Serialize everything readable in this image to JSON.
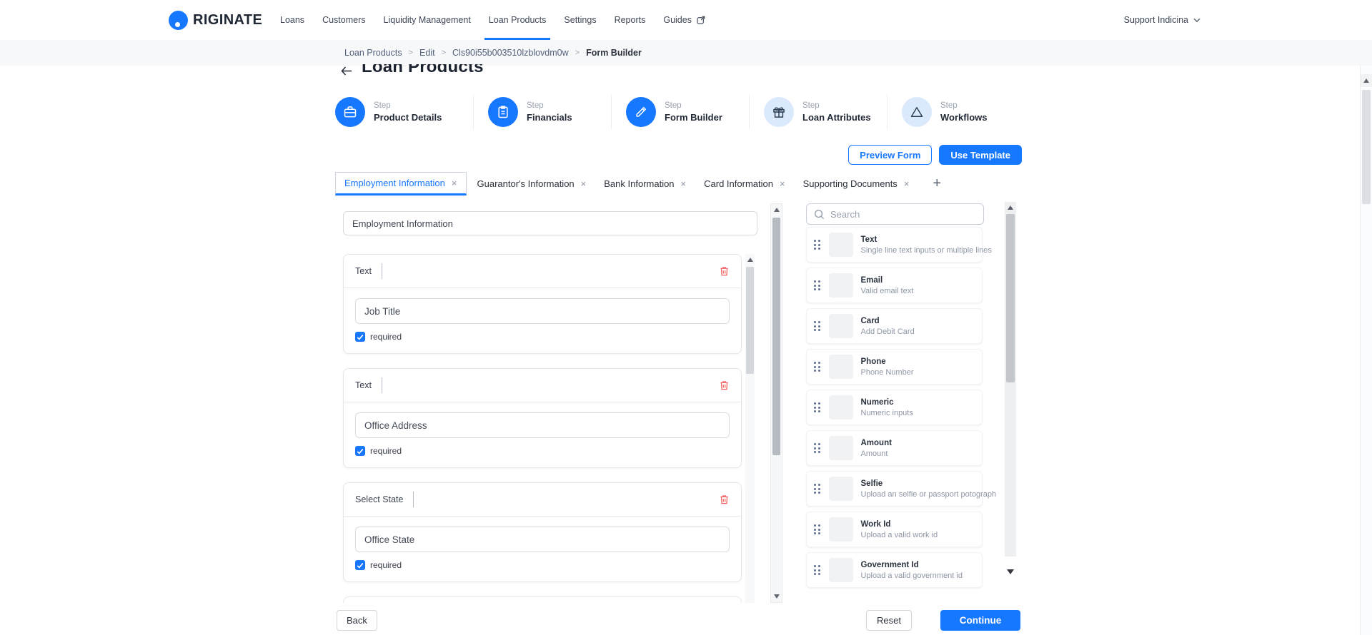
{
  "brand": {
    "logo_text": "RIGINATE"
  },
  "nav": {
    "items": [
      "Loans",
      "Customers",
      "Liquidity Management",
      "Loan Products",
      "Settings",
      "Reports",
      "Guides"
    ],
    "active_item": "Loan Products",
    "support_label": "Support Indicina"
  },
  "breadcrumb": {
    "separator": ">",
    "items": [
      "Loan Products",
      "Edit",
      "Cls90i55b003510lzblovdm0w",
      "Form Builder"
    ]
  },
  "page": {
    "title": "Loan Products"
  },
  "steps": [
    {
      "step_label": "Step",
      "name": "Product Details",
      "icon": "briefcase-icon",
      "variant": "solid"
    },
    {
      "step_label": "Step",
      "name": "Financials",
      "icon": "clipboard-icon",
      "variant": "solid"
    },
    {
      "step_label": "Step",
      "name": "Form Builder",
      "icon": "pen-icon",
      "variant": "solid"
    },
    {
      "step_label": "Step",
      "name": "Loan Attributes",
      "icon": "gift-icon",
      "variant": "light"
    },
    {
      "step_label": "Step",
      "name": "Workflows",
      "icon": "triangle-icon",
      "variant": "light"
    }
  ],
  "actions": {
    "preview_label": "Preview Form",
    "use_template_label": "Use Template"
  },
  "tabs": {
    "close_glyph": "×",
    "add_label": "+",
    "items": [
      {
        "label": "Employment Information",
        "active": true
      },
      {
        "label": "Guarantor's Information",
        "active": false
      },
      {
        "label": "Bank Information",
        "active": false
      },
      {
        "label": "Card Information",
        "active": false
      },
      {
        "label": "Supporting Documents",
        "active": false
      }
    ]
  },
  "form": {
    "section_name": "Employment Information",
    "fields": [
      {
        "type_label": "Text",
        "value": "Job Title",
        "required_label": "required",
        "required": true
      },
      {
        "type_label": "Text",
        "value": "Office Address",
        "required_label": "required",
        "required": true
      },
      {
        "type_label": "Select State",
        "value": "Office State",
        "required_label": "required",
        "required": true
      }
    ]
  },
  "palette": {
    "search_placeholder": "Search",
    "items": [
      {
        "title": "Text",
        "subtitle": "Single line text inputs or multiple lines"
      },
      {
        "title": "Email",
        "subtitle": "Valid email text"
      },
      {
        "title": "Card",
        "subtitle": "Add Debit Card"
      },
      {
        "title": "Phone",
        "subtitle": "Phone Number"
      },
      {
        "title": "Numeric",
        "subtitle": "Numeric inputs"
      },
      {
        "title": "Amount",
        "subtitle": "Amount"
      },
      {
        "title": "Selfie",
        "subtitle": "Upload an selfie or passport potograph"
      },
      {
        "title": "Work Id",
        "subtitle": "Upload a valid work id"
      },
      {
        "title": "Government Id",
        "subtitle": "Upload a valid government id"
      }
    ]
  },
  "footer": {
    "back_label": "Back",
    "reset_label": "Reset",
    "continue_label": "Continue"
  },
  "colors": {
    "primary": "#1677ff",
    "danger": "#f16063",
    "step_light_bg": "#dbe9fc",
    "breadcrumb_bg": "#f7f8f9"
  }
}
